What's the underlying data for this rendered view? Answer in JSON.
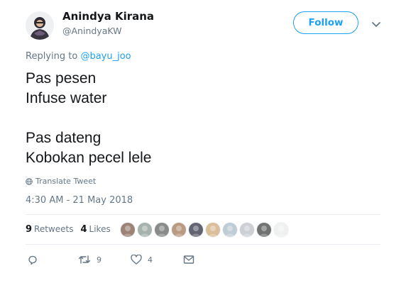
{
  "author": {
    "name": "Anindya Kirana",
    "handle": "@AnindyaKW"
  },
  "follow_label": "Follow",
  "replying": {
    "prefix": "Replying to",
    "mention": "@bayu_joo"
  },
  "tweet_lines": [
    "Pas pesen",
    "Infuse water",
    "",
    "Pas dateng",
    "Kobokan pecel lele"
  ],
  "translate_label": "Translate Tweet",
  "timestamp": "4:30 AM - 21 May 2018",
  "stats": {
    "retweets_count": "9",
    "retweets_label": "Retweets",
    "likes_count": "4",
    "likes_label": "Likes"
  },
  "likers": [
    {
      "color": "#8c6f60"
    },
    {
      "color": "#9aa7a0"
    },
    {
      "color": "#777777"
    },
    {
      "color": "#b08b6d"
    },
    {
      "color": "#4a4a5a"
    },
    {
      "color": "#d7b48a"
    },
    {
      "color": "#b7c4d0"
    },
    {
      "color": "#c5c9ce"
    },
    {
      "color": "#5b5b5b"
    },
    {
      "color": "#eeeeee"
    }
  ],
  "actions": {
    "reply_icon": "reply-icon",
    "retweet_icon": "retweet-icon",
    "retweet_count": "9",
    "like_icon": "heart-icon",
    "like_count": "4",
    "dm_icon": "envelope-icon"
  },
  "colors": {
    "accent": "#1da1f2",
    "secondary_text": "#657786"
  }
}
